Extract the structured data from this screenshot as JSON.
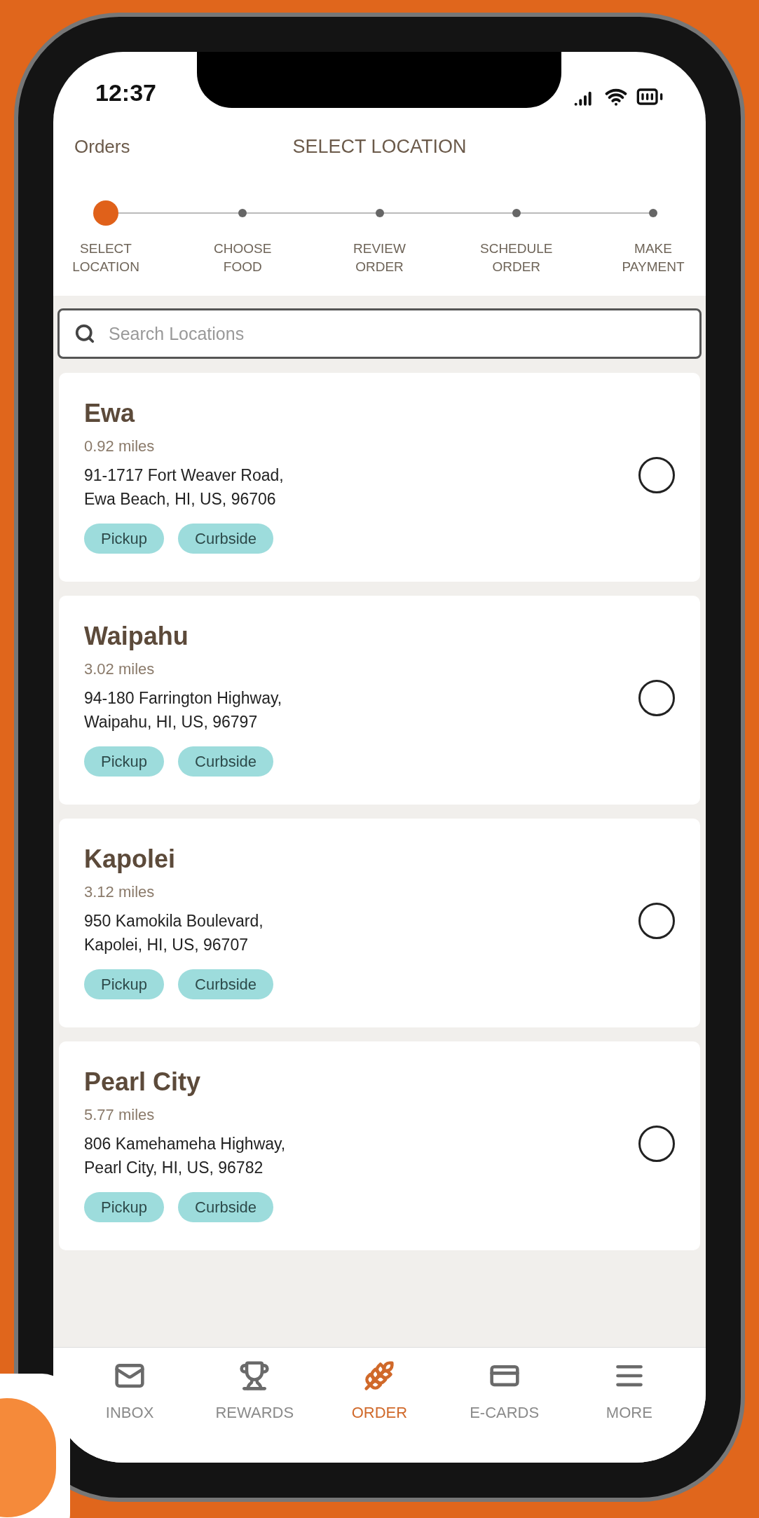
{
  "status_bar": {
    "time": "12:37"
  },
  "header": {
    "back": "Orders",
    "title": "SELECT LOCATION"
  },
  "steps": [
    {
      "label": "SELECT LOCATION",
      "selected": true
    },
    {
      "label": "CHOOSE FOOD",
      "selected": false
    },
    {
      "label": "REVIEW ORDER",
      "selected": false
    },
    {
      "label": "SCHEDULE ORDER",
      "selected": false
    },
    {
      "label": "MAKE PAYMENT",
      "selected": false
    }
  ],
  "search": {
    "placeholder": "Search Locations"
  },
  "locations": [
    {
      "name": "Ewa",
      "distance": "0.92 miles",
      "address_line_1": "91-1717 Fort Weaver Road,",
      "address_line_2": "Ewa Beach, HI, US, 96706",
      "tags": [
        "Pickup",
        "Curbside"
      ],
      "selected": false
    },
    {
      "name": "Waipahu",
      "distance": "3.02 miles",
      "address_line_1": "94-180 Farrington Highway,",
      "address_line_2": "Waipahu, HI, US, 96797",
      "tags": [
        "Pickup",
        "Curbside"
      ],
      "selected": false
    },
    {
      "name": "Kapolei",
      "distance": "3.12 miles",
      "address_line_1": "950 Kamokila Boulevard,",
      "address_line_2": "Kapolei, HI, US, 96707",
      "tags": [
        "Pickup",
        "Curbside"
      ],
      "selected": false
    },
    {
      "name": "Pearl City",
      "distance": "5.77 miles",
      "address_line_1": "806 Kamehameha Highway,",
      "address_line_2": "Pearl City, HI, US, 96782",
      "tags": [
        "Pickup",
        "Curbside"
      ],
      "selected": false
    }
  ],
  "tab_bar": [
    {
      "label": "INBOX",
      "kind": "inbox",
      "selected": false
    },
    {
      "label": "REWARDS",
      "kind": "rewards",
      "selected": false
    },
    {
      "label": "ORDER",
      "kind": "order",
      "selected": true
    },
    {
      "label": "E-CARDS",
      "kind": "ecards",
      "selected": false
    },
    {
      "label": "MORE",
      "kind": "more",
      "selected": false
    }
  ]
}
